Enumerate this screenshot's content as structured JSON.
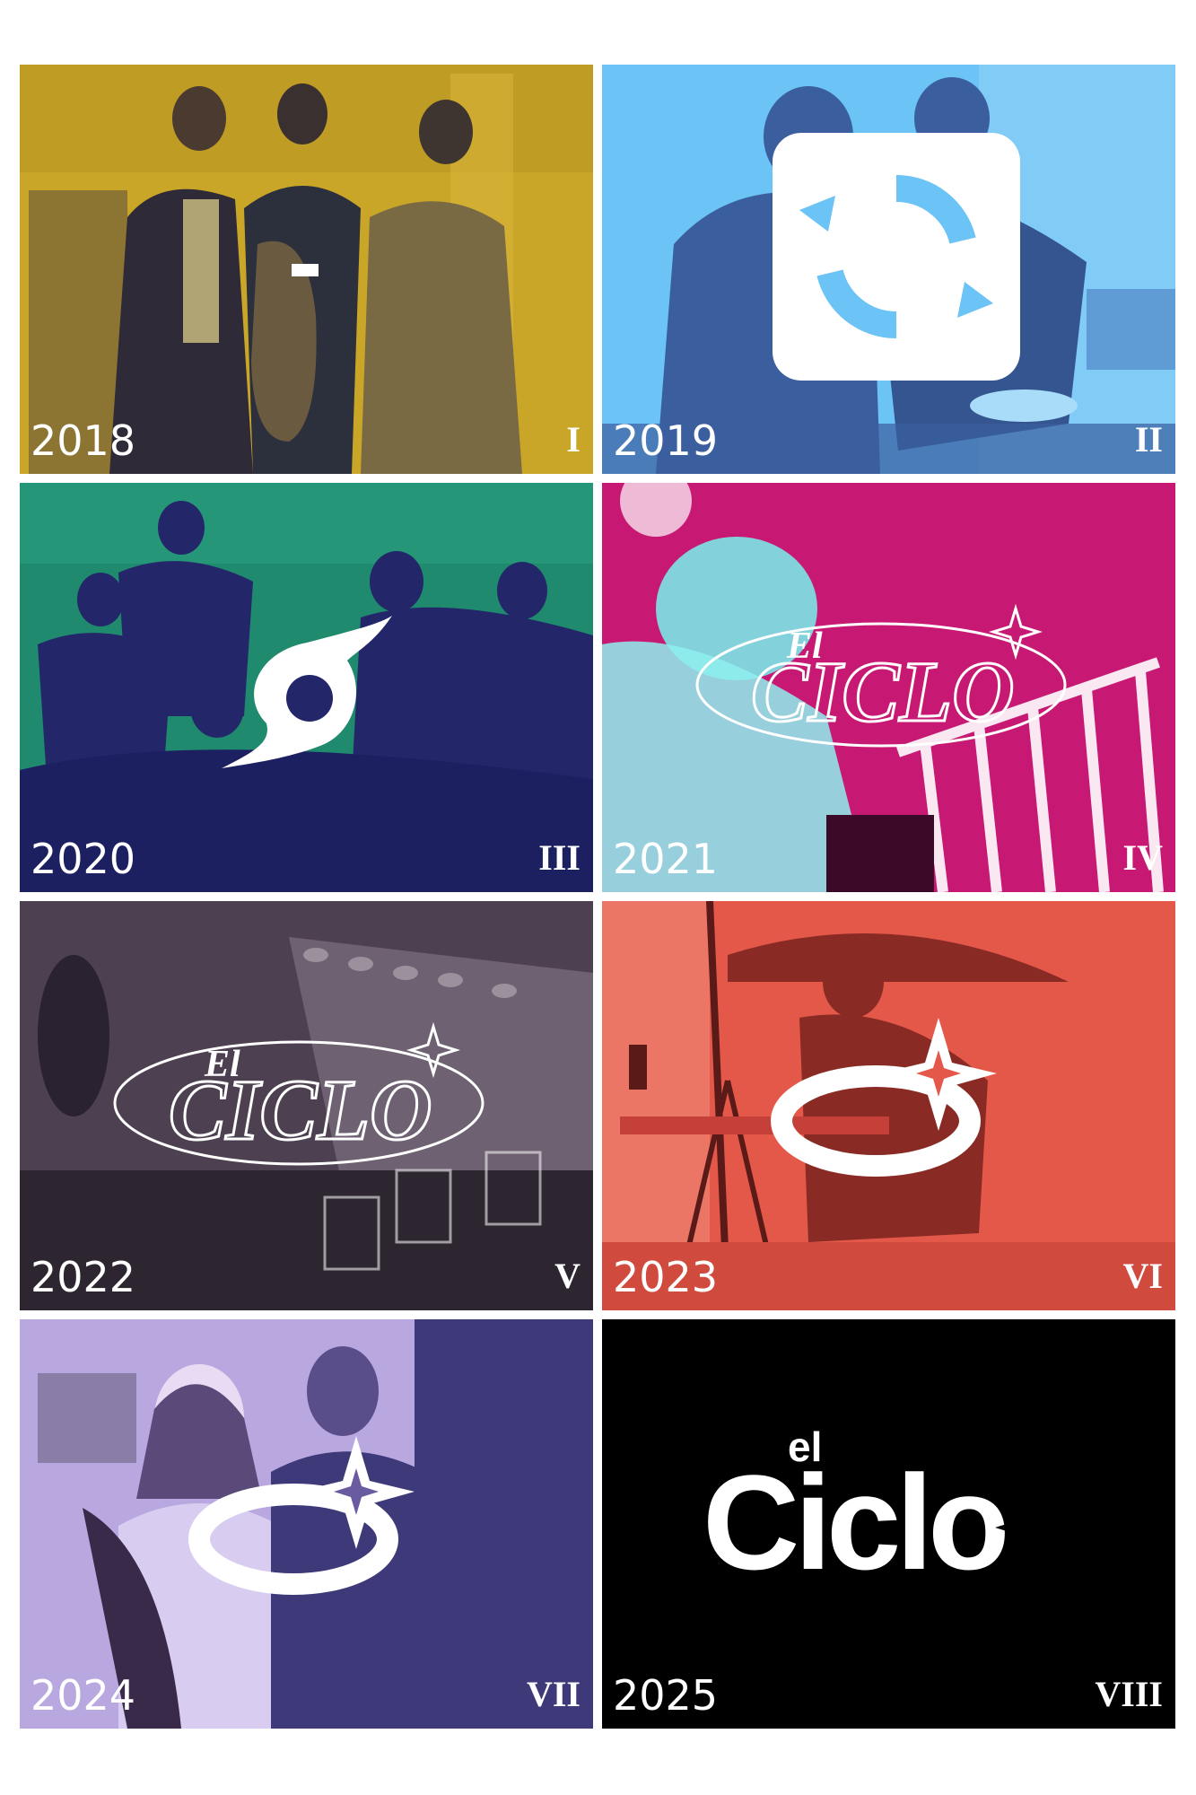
{
  "tiles": [
    {
      "year": "2018",
      "numeral": "I",
      "color": "#c9a628",
      "dark": "#4a3e48",
      "logo": "bar-icon"
    },
    {
      "year": "2019",
      "numeral": "II",
      "color": "#6cc3f5",
      "dark": "#3a5e9e",
      "logo": "refresh-icon"
    },
    {
      "year": "2020",
      "numeral": "III",
      "color": "#1f8a6e",
      "dark": "#23276a",
      "logo": "hurricane-icon"
    },
    {
      "year": "2021",
      "numeral": "IV",
      "color": "#c2186f",
      "dark": "#7c0f4a",
      "logo": "el-ciclo-wordmark",
      "logo_small": "El",
      "logo_big": "CICLO"
    },
    {
      "year": "2022",
      "numeral": "V",
      "color": "#4d4050",
      "dark": "#241c2a",
      "logo": "el-ciclo-wordmark",
      "logo_small": "El",
      "logo_big": "CICLO"
    },
    {
      "year": "2023",
      "numeral": "VI",
      "color": "#e4584a",
      "dark": "#8a2a24",
      "logo": "ring-star-icon"
    },
    {
      "year": "2024",
      "numeral": "VII",
      "color": "#b9a8e0",
      "dark": "#3e3a7a",
      "logo": "ring-star-icon"
    },
    {
      "year": "2025",
      "numeral": "VIII",
      "color": "#000000",
      "dark": "#000000",
      "logo": "el-ciclo-block-logo",
      "logo_small": "el",
      "logo_big": "Ciclo"
    }
  ]
}
